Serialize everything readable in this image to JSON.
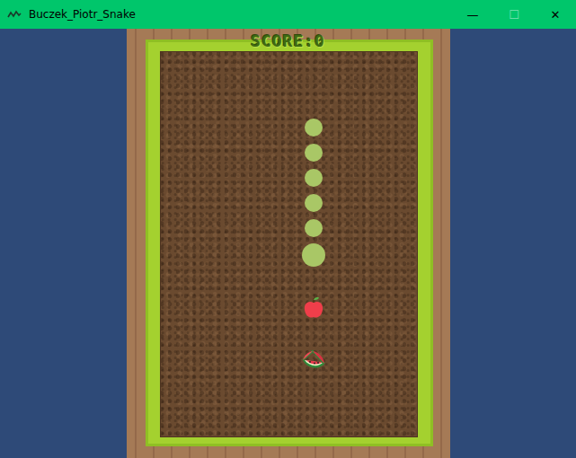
{
  "window": {
    "title": "Buczek_Piotr_Snake",
    "controls": [
      {
        "label": "—",
        "disabled": false
      },
      {
        "label": "☐",
        "disabled": true
      },
      {
        "label": "✕",
        "disabled": false
      }
    ]
  },
  "score": "SCORE:0",
  "snake": [
    {
      "kind": "body"
    },
    {
      "kind": "body"
    },
    {
      "kind": "body"
    },
    {
      "kind": "body"
    },
    {
      "kind": "body"
    },
    {
      "kind": "head"
    }
  ],
  "fruits": [
    {
      "kind": "apple"
    },
    {
      "kind": "watermelon"
    }
  ]
}
